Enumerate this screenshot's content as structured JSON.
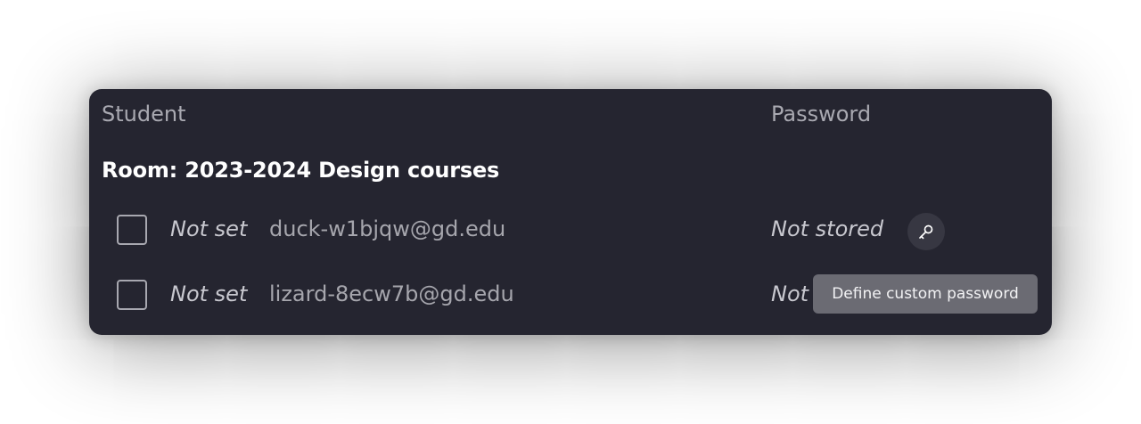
{
  "table": {
    "headers": {
      "student": "Student",
      "password": "Password"
    },
    "room_title": "Room: 2023-2024 Design courses",
    "rows": [
      {
        "name": "Not set",
        "email": "duck-w1bjqw@gd.edu",
        "password_status": "Not stored",
        "checked": false
      },
      {
        "name": "Not set",
        "email": "lizard-8ecw7b@gd.edu",
        "password_status": "Not stored",
        "checked": false
      }
    ]
  },
  "tooltip": {
    "text": "Define custom password"
  },
  "icons": {
    "password_action": "key-icon"
  },
  "colors": {
    "panel_bg": "#252530",
    "tooltip_bg": "#6b6b73",
    "text_primary": "#ffffff"
  }
}
